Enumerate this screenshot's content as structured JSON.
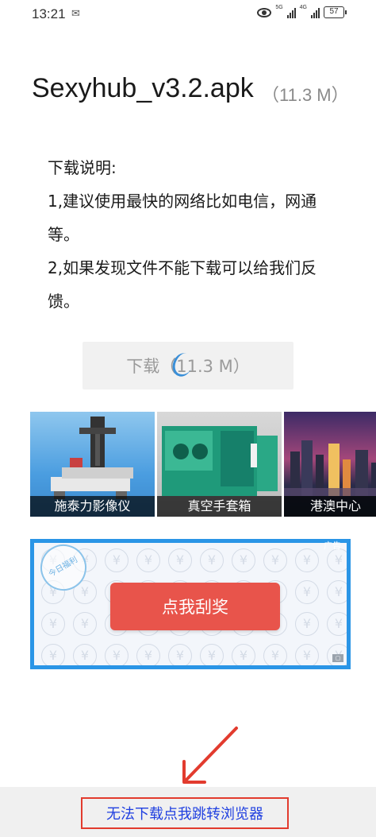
{
  "status_bar": {
    "time": "13:21",
    "battery": "57",
    "net1": "5G",
    "net2": "4G"
  },
  "file": {
    "name": "Sexyhub_v3.2.apk",
    "size": "（11.3 M）"
  },
  "description": {
    "heading": "下载说明:",
    "line1": "1,建议使用最快的网络比如电信，网通等。",
    "line2": "2,如果发现文件不能下载可以给我们反馈。"
  },
  "download_button": {
    "label": "下载（11.3 M）"
  },
  "ad_tiles": [
    {
      "caption": "施泰力影像仪"
    },
    {
      "caption": "真空手套箱"
    },
    {
      "caption": "港澳中心"
    }
  ],
  "scratch_ad": {
    "stamp": "今日福利",
    "button": "点我刮奖",
    "corner_text": "广告"
  },
  "bottom": {
    "jump_link": "无法下载点我跳转浏览器"
  },
  "colors": {
    "accent_blue": "#2a95e6",
    "scratch_red": "#e8544b",
    "link_blue": "#1f3fe0",
    "annotation_red": "#e23b2e"
  }
}
